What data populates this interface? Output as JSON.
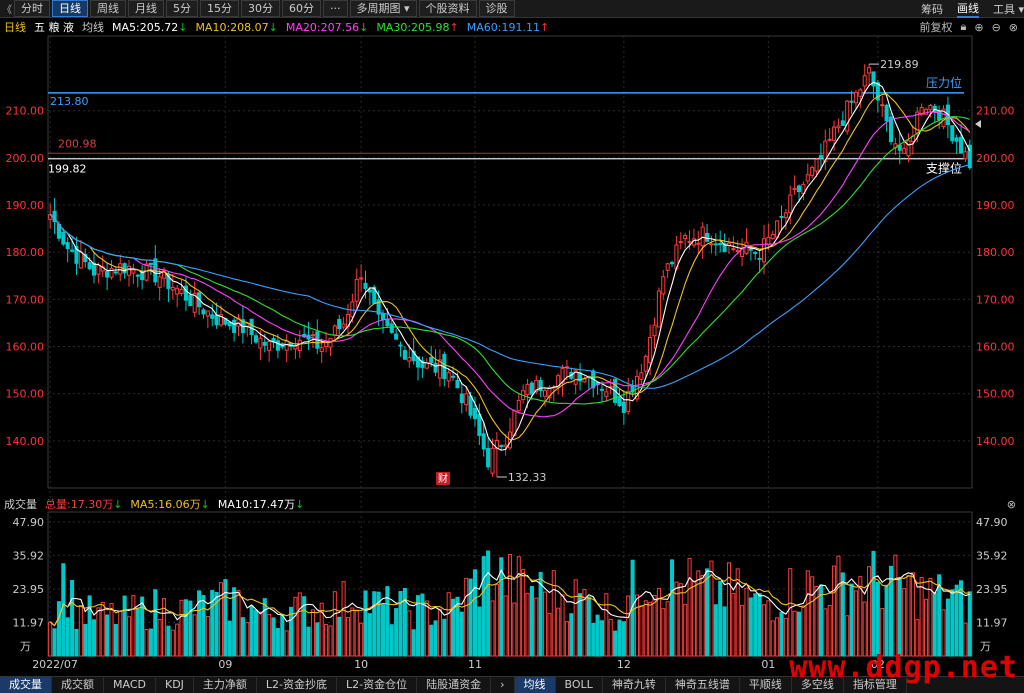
{
  "toolbar": {
    "back_glyph": "《",
    "periods": [
      "分时",
      "日线",
      "周线",
      "月线",
      "5分",
      "15分",
      "30分",
      "60分",
      "···",
      "多周期图 ▾",
      "个股资料",
      "诊股"
    ],
    "active_period_index": 1,
    "right": [
      "筹码",
      "画线",
      "工具 ▾"
    ],
    "right_highlight_index": 1
  },
  "info": {
    "period": "日线",
    "stock_name": "五 粮 液",
    "indicator": "均线",
    "ma": [
      {
        "label": "MA5:205.72",
        "arrow": "↓",
        "color": "#ffffff",
        "arrow_color": "#00d000"
      },
      {
        "label": "MA10:208.07",
        "arrow": "↓",
        "color": "#f0c020",
        "arrow_color": "#00d000"
      },
      {
        "label": "MA20:207.56",
        "arrow": "↓",
        "color": "#ff40ff",
        "arrow_color": "#00d000"
      },
      {
        "label": "MA30:205.98",
        "arrow": "↑",
        "color": "#30e030",
        "arrow_color": "#ff3030"
      },
      {
        "label": "MA60:191.11",
        "arrow": "↑",
        "color": "#3aa0ff",
        "arrow_color": "#ff3030"
      }
    ],
    "adjust": "前复权",
    "controls_icons": [
      "lock-icon",
      "plus-icon",
      "minus-icon",
      "close-icon"
    ]
  },
  "colors": {
    "up": "#ff3a3a",
    "down": "#00c8c8",
    "grid": "#2a2a2a",
    "axis_text": "#ff3333",
    "vol_axis_text": "#cccccc",
    "resistance": "#3aa0ff",
    "support": "#e0e0e0"
  },
  "annotations": {
    "resistance_value": "213.80",
    "resistance_label": "压力位",
    "mid_value": "200.98",
    "support_value": "199.82",
    "support_label": "支撑位",
    "high_label": "219.89",
    "low_label": "132.33",
    "cai_badge": "财"
  },
  "volume": {
    "title": "成交量",
    "total": "总量:17.30万",
    "total_arrow": "↓",
    "ma5": "MA5:16.06万",
    "ma5_arrow": "↓",
    "ma10": "MA10:17.47万",
    "ma10_arrow": "↓",
    "unit": "万",
    "close_icon": "close-icon"
  },
  "bottom_tabs": [
    "成交量",
    "成交额",
    "MACD",
    "KDJ",
    "主力净额",
    "L2-资金抄底",
    "L2-资金仓位",
    "陆股通资金",
    "›",
    "均线",
    "BOLL",
    "神奇九转",
    "神奇五线谱",
    "平顺线",
    "多空线",
    "指标管理"
  ],
  "bottom_active": [
    0,
    9
  ],
  "watermark": "www.ddgp.net",
  "chart_data": {
    "type": "candlestick",
    "price_axis_ticks": [
      210,
      200,
      190,
      180,
      170,
      160,
      150,
      140
    ],
    "price_axis_labels": [
      "210.00",
      "200.00",
      "190.00",
      "180.00",
      "170.00",
      "160.00",
      "150.00",
      "140.00"
    ],
    "ylim": [
      130,
      225
    ],
    "volume_axis_labels": [
      "47.90",
      "35.92",
      "23.95",
      "11.97"
    ],
    "volume_ylim": [
      0,
      50
    ],
    "x_labels": [
      "2022/07",
      "09",
      "10",
      "11",
      "12",
      "01",
      "02"
    ],
    "x_label_index": [
      0,
      40,
      71,
      97,
      131,
      164,
      189
    ],
    "levels": {
      "resistance": 213.8,
      "mid": 200.98,
      "support": 199.82
    },
    "high": {
      "value": 219.89,
      "index": 187
    },
    "low": {
      "value": 132.33,
      "index": 102
    },
    "anchors": {
      "close": [
        [
          0,
          188
        ],
        [
          4,
          181
        ],
        [
          10,
          176
        ],
        [
          17,
          177
        ],
        [
          25,
          175
        ],
        [
          32,
          170
        ],
        [
          38,
          166
        ],
        [
          44,
          164
        ],
        [
          50,
          160
        ],
        [
          56,
          162
        ],
        [
          62,
          160
        ],
        [
          67,
          165
        ],
        [
          71,
          176
        ],
        [
          75,
          165
        ],
        [
          80,
          160
        ],
        [
          85,
          156
        ],
        [
          91,
          155
        ],
        [
          95,
          148
        ],
        [
          100,
          136
        ],
        [
          104,
          141
        ],
        [
          108,
          150
        ],
        [
          114,
          153
        ],
        [
          120,
          155
        ],
        [
          126,
          152
        ],
        [
          131,
          148
        ],
        [
          136,
          158
        ],
        [
          140,
          175
        ],
        [
          145,
          183
        ],
        [
          150,
          184
        ],
        [
          156,
          181
        ],
        [
          162,
          180
        ],
        [
          166,
          185
        ],
        [
          170,
          192
        ],
        [
          175,
          198
        ],
        [
          180,
          207
        ],
        [
          187,
          218
        ],
        [
          191,
          207
        ],
        [
          195,
          200
        ],
        [
          199,
          212
        ],
        [
          203,
          210
        ],
        [
          207,
          204
        ],
        [
          210,
          199
        ]
      ],
      "vol": [
        [
          0,
          12
        ],
        [
          3,
          28
        ],
        [
          6,
          16
        ],
        [
          12,
          14
        ],
        [
          18,
          15
        ],
        [
          24,
          17
        ],
        [
          30,
          16
        ],
        [
          36,
          18
        ],
        [
          42,
          20
        ],
        [
          48,
          15
        ],
        [
          54,
          16
        ],
        [
          60,
          17
        ],
        [
          66,
          18
        ],
        [
          70,
          22
        ],
        [
          74,
          18
        ],
        [
          80,
          17
        ],
        [
          86,
          16
        ],
        [
          92,
          17
        ],
        [
          96,
          24
        ],
        [
          100,
          30
        ],
        [
          104,
          27
        ],
        [
          108,
          25
        ],
        [
          112,
          23
        ],
        [
          118,
          22
        ],
        [
          124,
          19
        ],
        [
          130,
          15
        ],
        [
          134,
          27
        ],
        [
          138,
          30
        ],
        [
          142,
          26
        ],
        [
          146,
          25
        ],
        [
          150,
          24
        ],
        [
          156,
          23
        ],
        [
          162,
          18
        ],
        [
          166,
          21
        ],
        [
          170,
          24
        ],
        [
          176,
          25
        ],
        [
          182,
          26
        ],
        [
          188,
          27
        ],
        [
          194,
          25
        ],
        [
          200,
          22
        ],
        [
          206,
          21
        ],
        [
          210,
          18
        ]
      ]
    },
    "ma_series": [
      {
        "name": "MA5",
        "period": 5,
        "color": "#ffffff"
      },
      {
        "name": "MA10",
        "period": 10,
        "color": "#f0c020"
      },
      {
        "name": "MA20",
        "period": 20,
        "color": "#ff40ff"
      },
      {
        "name": "MA30",
        "period": 30,
        "color": "#30e030"
      },
      {
        "name": "MA60",
        "period": 60,
        "color": "#3aa0ff"
      }
    ],
    "vol_ma_series": [
      {
        "name": "MA5",
        "period": 5,
        "color": "#ffffff"
      },
      {
        "name": "MA10",
        "period": 10,
        "color": "#f0c020"
      }
    ]
  }
}
